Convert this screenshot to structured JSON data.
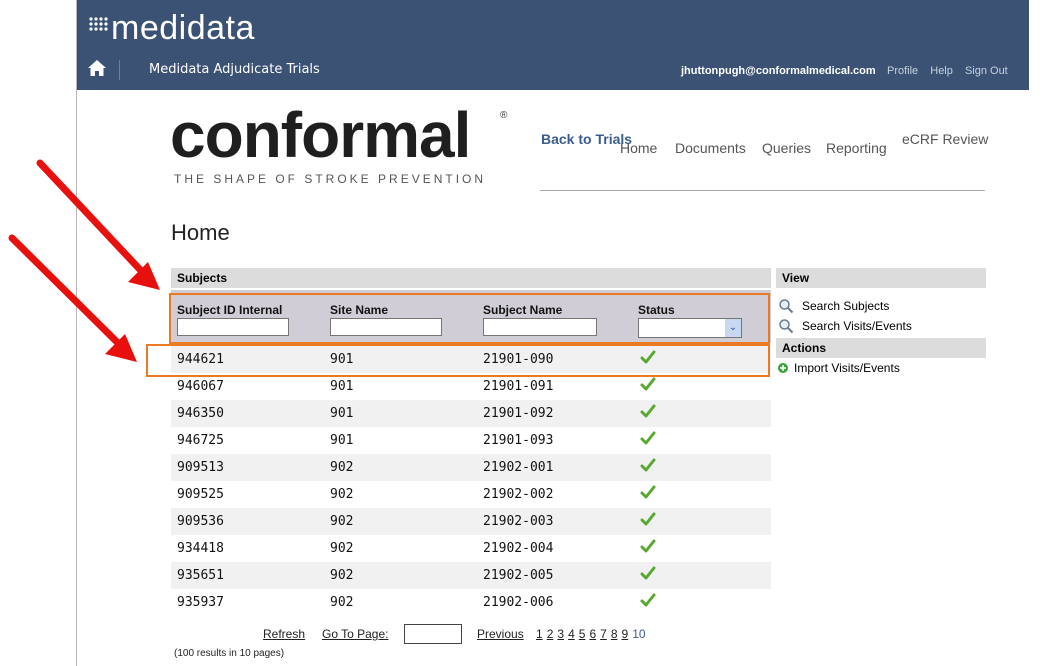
{
  "header": {
    "logo_text": "medidata",
    "app_title": "Medidata Adjudicate Trials",
    "user_email": "jhuttonpugh@conformalmedical.com",
    "links": [
      "Profile",
      "Help",
      "Sign Out"
    ],
    "bar_color": "#3b5274"
  },
  "brand": {
    "name": "conformal",
    "tagline": "THE SHAPE OF STROKE PREVENTION"
  },
  "nav": {
    "back": "Back to Trials",
    "home": "Home",
    "documents": "Documents",
    "queries": "Queries",
    "reporting": "Reporting",
    "ecrf": "eCRF Review"
  },
  "page": {
    "title": "Home"
  },
  "subjects": {
    "heading": "Subjects",
    "columns": [
      "Subject ID Internal",
      "Site Name",
      "Subject Name",
      "Status"
    ],
    "rows": [
      {
        "id": "944621",
        "site": "901",
        "name": "21901-090",
        "status": "check"
      },
      {
        "id": "946067",
        "site": "901",
        "name": "21901-091",
        "status": "check"
      },
      {
        "id": "946350",
        "site": "901",
        "name": "21901-092",
        "status": "check"
      },
      {
        "id": "946725",
        "site": "901",
        "name": "21901-093",
        "status": "check"
      },
      {
        "id": "909513",
        "site": "902",
        "name": "21902-001",
        "status": "check"
      },
      {
        "id": "909525",
        "site": "902",
        "name": "21902-002",
        "status": "check"
      },
      {
        "id": "909536",
        "site": "902",
        "name": "21902-003",
        "status": "check"
      },
      {
        "id": "934418",
        "site": "902",
        "name": "21902-004",
        "status": "check"
      },
      {
        "id": "935651",
        "site": "902",
        "name": "21902-005",
        "status": "check"
      },
      {
        "id": "935937",
        "site": "902",
        "name": "21902-006",
        "status": "check"
      }
    ],
    "status_color": "#5aa832"
  },
  "pager": {
    "refresh": "Refresh",
    "goto": "Go To Page:",
    "previous": "Previous",
    "pages": [
      "1",
      "2",
      "3",
      "4",
      "5",
      "6",
      "7",
      "8",
      "9"
    ],
    "current": "10",
    "count_text": "(100 results in 10 pages)"
  },
  "sidebar": {
    "view_heading": "View",
    "search_subjects": "Search Subjects",
    "search_visits": "Search Visits/Events",
    "actions_heading": "Actions",
    "import_visits": "Import Visits/Events"
  },
  "annotations": {
    "highlight_color": "#ec7a24",
    "arrow_color": "#e8100d"
  }
}
